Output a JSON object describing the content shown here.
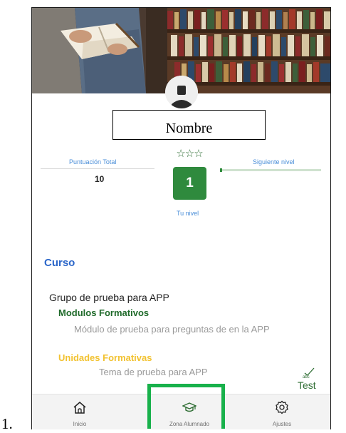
{
  "list_marker": "1.",
  "profile": {
    "name": "Nombre"
  },
  "stats": {
    "score_label": "Puntuación Total",
    "score_value": "10",
    "next_level_label": "Siguiente nivel",
    "next_level_progress": 0.02,
    "stars": "☆☆☆",
    "level_value": "1",
    "level_label": "Tu nivel"
  },
  "course": {
    "title": "Curso",
    "group_name": "Grupo de prueba para APP",
    "modules_title": "Modulos Formativos",
    "module_name": "Módulo de prueba para preguntas de en la APP",
    "units_title": "Unidades Formativas",
    "unit_name": "Tema de prueba para APP",
    "test_label": "Test",
    "test_icon": "spellcheck-icon"
  },
  "bottom_nav": {
    "items": [
      {
        "label": "Inicio",
        "icon": "home-icon"
      },
      {
        "label": "Zona Alumnado",
        "icon": "graduation-cap-icon"
      },
      {
        "label": "Ajustes",
        "icon": "gear-icon"
      }
    ],
    "highlighted_index": 1
  },
  "colors": {
    "accent_green": "#2f8a3d",
    "link_blue": "#4a8ed8",
    "course_blue": "#2b66c9",
    "units_yellow": "#f2c230",
    "highlight_green": "#18b14b"
  }
}
